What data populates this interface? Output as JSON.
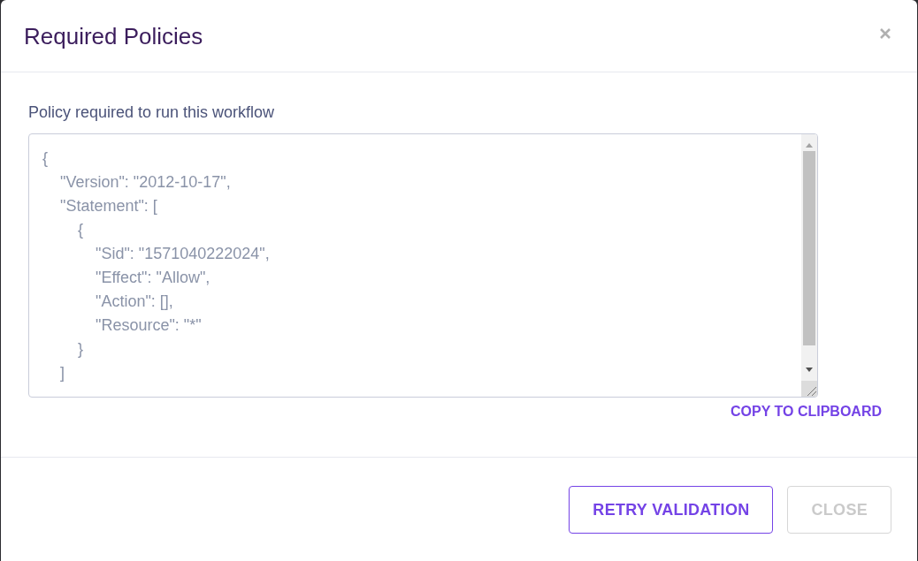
{
  "dialog": {
    "title": "Required Policies"
  },
  "body": {
    "label": "Policy required to run this workflow",
    "policy_text": "{\n    \"Version\": \"2012-10-17\",\n    \"Statement\": [\n        {\n            \"Sid\": \"1571040222024\",\n            \"Effect\": \"Allow\",\n            \"Action\": [],\n            \"Resource\": \"*\"\n        }\n    ]",
    "copy_link": "COPY TO CLIPBOARD"
  },
  "footer": {
    "buttons": [
      {
        "label": "RETRY VALIDATION",
        "disabled": false
      },
      {
        "label": "CLOSE",
        "disabled": true
      }
    ]
  }
}
